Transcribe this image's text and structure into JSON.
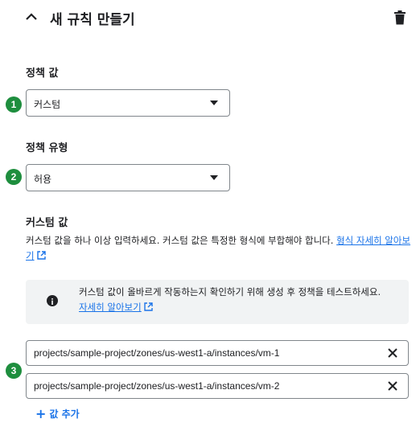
{
  "header": {
    "title": "새 규칙 만들기"
  },
  "policy_value": {
    "label": "정책 값",
    "selected": "커스텀",
    "badge": "1"
  },
  "policy_type": {
    "label": "정책 유형",
    "selected": "허용",
    "badge": "2"
  },
  "custom_values": {
    "label": "커스텀 값",
    "description": "커스텀 값을 하나 이상 입력하세요. 커스텀 값은 특정한 형식에 부합해야 합니다. ",
    "link_text": "형식 자세히 알아보기",
    "info_text": "커스텀 값이 올바르게 작동하는지 확인하기 위해 생성 후 정책을 테스트하세요.",
    "info_link": "자세히 알아보기",
    "badge": "3",
    "values": [
      "projects/sample-project/zones/us-west1-a/instances/vm-1",
      "projects/sample-project/zones/us-west1-a/instances/vm-2"
    ],
    "add_label": "값 추가"
  },
  "colors": {
    "accent": "#1a73e8",
    "badge": "#1e8e3e",
    "info_bg": "#f1f3f4"
  }
}
